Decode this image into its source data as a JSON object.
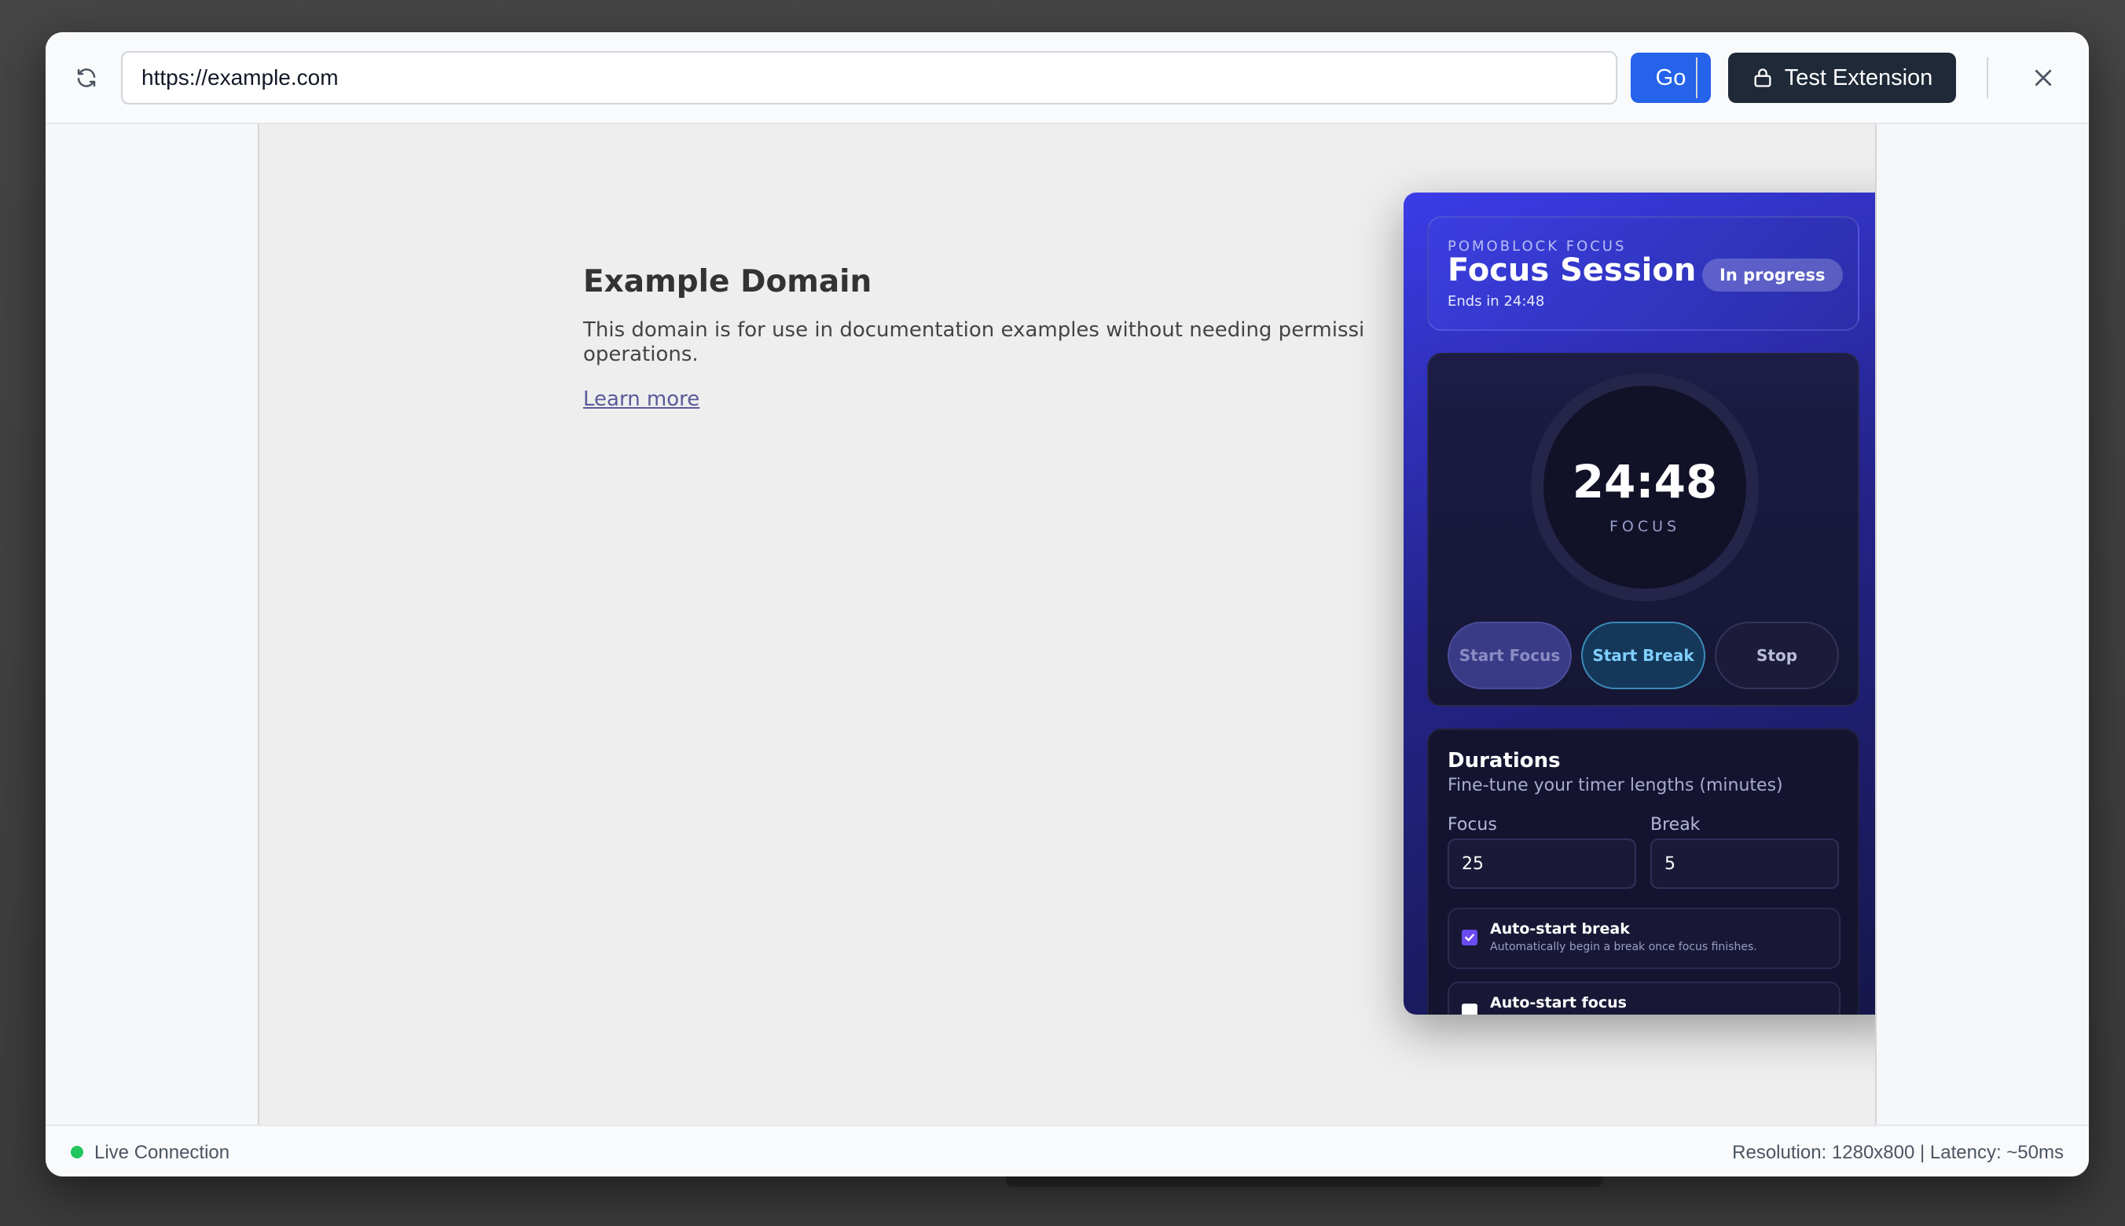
{
  "toolbar": {
    "reload_icon": "reload-icon",
    "url_value": "https://example.com",
    "go_label": "Go",
    "test_extension_label": "Test Extension",
    "test_extension_icon": "lock-icon",
    "close_icon": "close-icon"
  },
  "page": {
    "title": "Example Domain",
    "description_line1": "This domain is for use in documentation examples without needing permissi",
    "description_line2": "operations.",
    "link_label": "Learn more"
  },
  "popup": {
    "eyebrow": "POMOBLOCK FOCUS",
    "title": "Focus Session",
    "badge": "In progress",
    "subtitle": "Ends in 24:48",
    "timer": {
      "time": "24:48",
      "mode": "FOCUS"
    },
    "controls": {
      "start_focus": "Start Focus",
      "start_break": "Start Break",
      "stop": "Stop"
    },
    "durations": {
      "title": "Durations",
      "subtitle": "Fine-tune your timer lengths (minutes)",
      "focus_label": "Focus",
      "focus_value": "25",
      "break_label": "Break",
      "break_value": "5"
    },
    "toggles": [
      {
        "label": "Auto-start break",
        "help": "Automatically begin a break once focus finishes.",
        "checked": true
      },
      {
        "label": "Auto-start focus",
        "help": "",
        "checked": false
      }
    ]
  },
  "status": {
    "connection": "Live Connection",
    "info": "Resolution: 1280x800 | Latency: ~50ms"
  },
  "colors": {
    "accent": "#2563eb",
    "dark_button": "#1f2937",
    "live": "#22c55e",
    "popup_primary": "#3a3ce8"
  }
}
